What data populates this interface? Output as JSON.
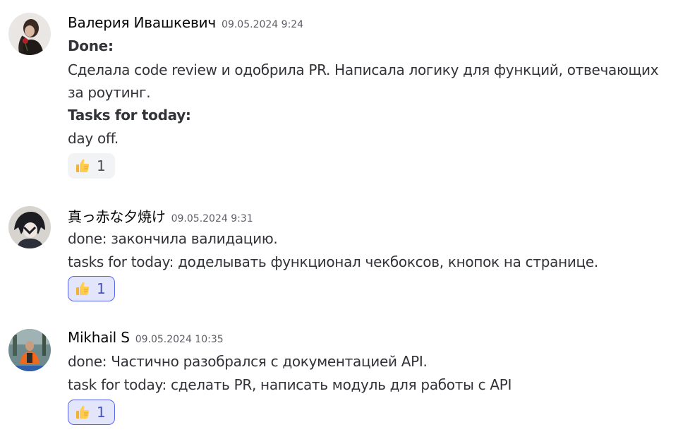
{
  "messages": [
    {
      "author": "Валерия Ивашкевич",
      "timestamp": "09.05.2024 9:24",
      "lines": [
        {
          "text": "Done:",
          "bold": true
        },
        {
          "text": "Сделала code review и одобрила PR. Написала логику для функций, отвечающих",
          "bold": false
        },
        {
          "text": "за роутинг.",
          "bold": false
        },
        {
          "text": "Tasks for today:",
          "bold": true
        },
        {
          "text": "day off.",
          "bold": false
        }
      ],
      "reaction": {
        "emoji": "thumbs-up-icon",
        "count": "1",
        "reacted": false
      }
    },
    {
      "author": "真っ赤な夕焼け",
      "timestamp": "09.05.2024 9:31",
      "lines": [
        {
          "text": "done: закончила валидацию.",
          "bold": false
        },
        {
          "text": "tasks for today: доделывать функционал чекбоксов, кнопок на странице.",
          "bold": false
        }
      ],
      "reaction": {
        "emoji": "thumbs-up-icon",
        "count": "1",
        "reacted": true
      }
    },
    {
      "author": "Mikhail S",
      "timestamp": "09.05.2024 10:35",
      "lines": [
        {
          "text": "done: Частично разобрался с документацией API.",
          "bold": false
        },
        {
          "text": "task for today: сделать PR, написать модуль для работы с API",
          "bold": false
        }
      ],
      "reaction": {
        "emoji": "thumbs-up-icon",
        "count": "1",
        "reacted": true
      }
    }
  ],
  "colors": {
    "reaction_active_border": "#5865f2",
    "reaction_active_bg": "#e3e6fb",
    "reaction_plain_bg": "#f2f3f5",
    "timestamp": "#5c5e66",
    "text": "#313338"
  }
}
